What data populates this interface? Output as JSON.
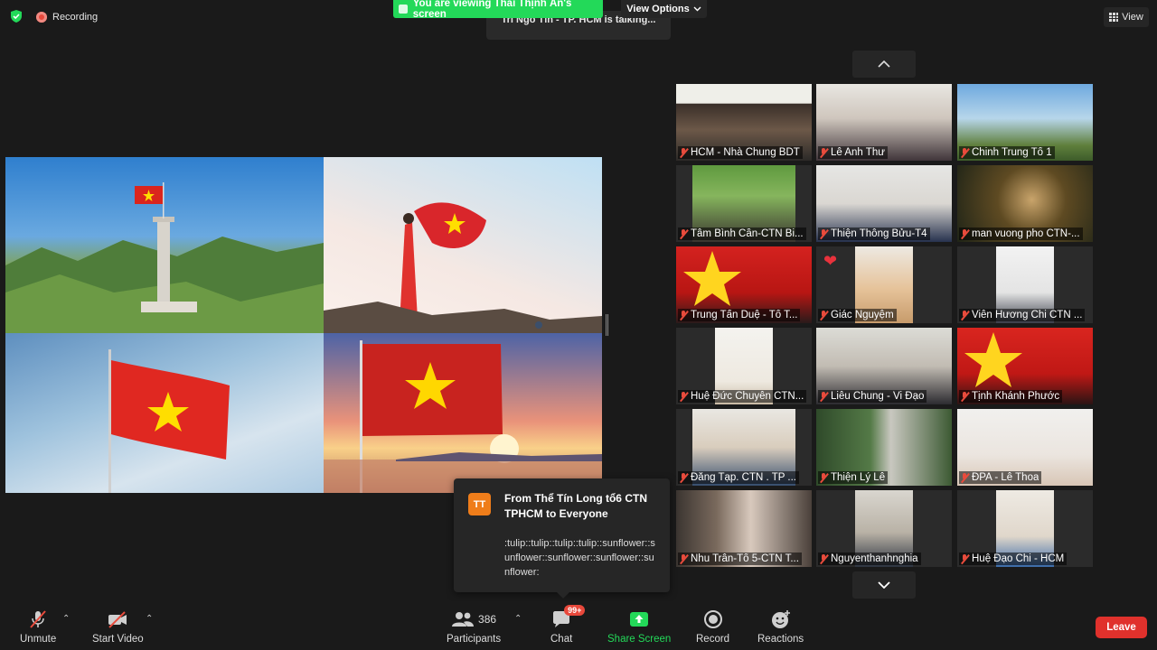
{
  "topbar": {
    "recording_label": "Recording",
    "viewing_banner": "You are viewing Thái Thịnh Ân's screen",
    "view_options_label": "View Options",
    "talking_text": "Tri Ngô Tín - TP. HCM is talking...",
    "view_label": "View"
  },
  "participants_gallery": [
    {
      "name": "HCM - Nhà Chung BDT"
    },
    {
      "name": "Lê Anh Thư"
    },
    {
      "name": "Chinh Trung Tổ 1"
    },
    {
      "name": "Tâm Bình Cần-CTN Bi..."
    },
    {
      "name": "Thiện Thông Bửu-T4"
    },
    {
      "name": "man vuong pho CTN-..."
    },
    {
      "name": "Trung Tấn Duệ - Tổ T..."
    },
    {
      "name": "Giác Nguyệm"
    },
    {
      "name": "Viên Hương Chi CTN ..."
    },
    {
      "name": "Huệ Đức Chuyên CTN..."
    },
    {
      "name": "Liễu Chung -  Vi Đạo"
    },
    {
      "name": "Tịnh Khánh Phước"
    },
    {
      "name": "Đăng Tạp. CTN . TP ..."
    },
    {
      "name": "Thiện Lý Lê"
    },
    {
      "name": "ĐPA - Lê Thoa"
    },
    {
      "name": "Nhu Trân-Tổ 5-CTN T..."
    },
    {
      "name": "Nguyenthanhnghia"
    },
    {
      "name": "Huệ Đạo Chi - HCM"
    }
  ],
  "chat_notification": {
    "avatar_initials": "TT",
    "from": "From Thể Tín Long  tổ6 CTN TPHCM to Everyone",
    "message": ":tulip::tulip::tulip::tulip::sunflower::sunflower::sunflower::sunflower::sunflower:"
  },
  "toolbar": {
    "unmute_label": "Unmute",
    "start_video_label": "Start Video",
    "participants_count": "386",
    "participants_label": "Participants",
    "chat_badge": "99+",
    "chat_label": "Chat",
    "share_screen_label": "Share Screen",
    "record_label": "Record",
    "reactions_label": "Reactions",
    "leave_label": "Leave"
  },
  "colors": {
    "banner_green": "#23d959",
    "leave_red": "#e0312c",
    "recording_red": "#e8483b",
    "avatar_orange": "#ef7d1a"
  }
}
